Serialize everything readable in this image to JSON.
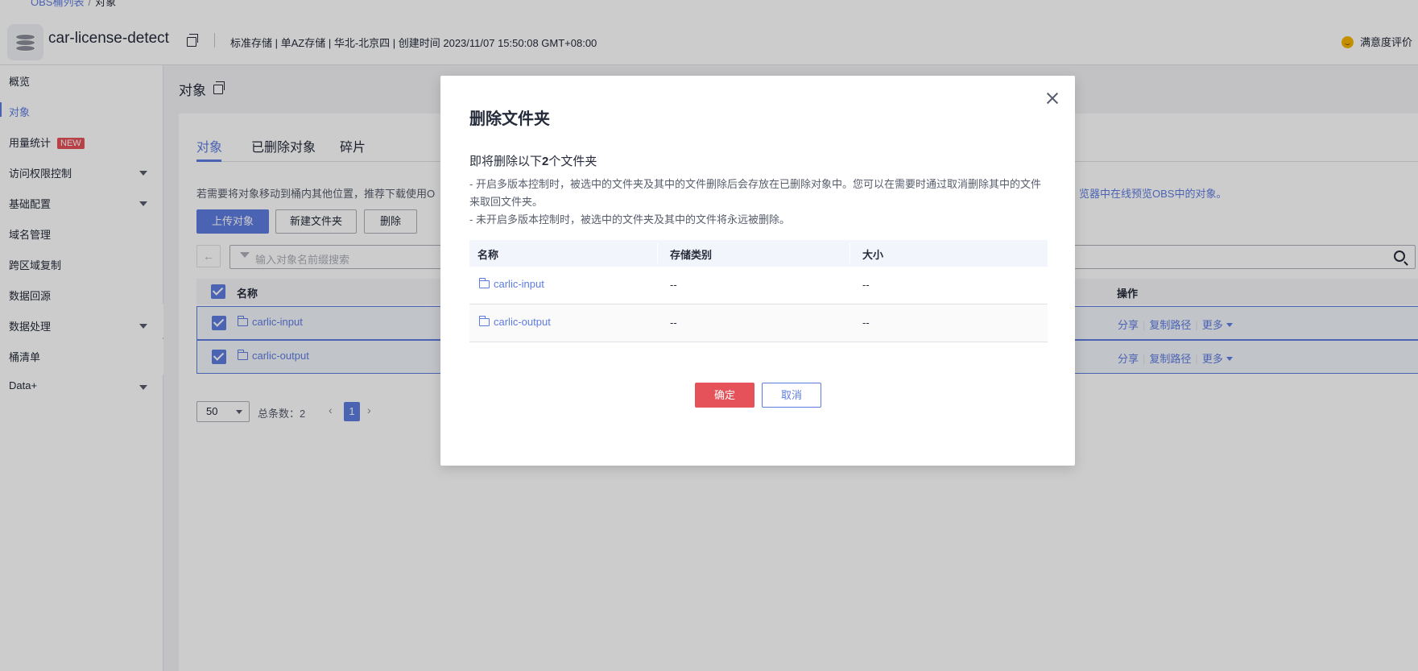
{
  "breadcrumb": {
    "parent": "OBS桶列表",
    "current": "对象"
  },
  "header": {
    "bucket_name": "car-license-detect",
    "meta": "标准存储 | 单AZ存储 | 华北-北京四 | 创建时间  2023/11/07 15:50:08 GMT+08:00",
    "satisfaction": "满意度评价"
  },
  "sidebar": {
    "items": [
      {
        "label": "概览"
      },
      {
        "label": "对象"
      },
      {
        "label": "用量统计",
        "badge": "NEW"
      },
      {
        "label": "访问权限控制"
      },
      {
        "label": "基础配置"
      },
      {
        "label": "域名管理"
      },
      {
        "label": "跨区域复制"
      },
      {
        "label": "数据回源"
      },
      {
        "label": "数据处理"
      },
      {
        "label": "桶清单"
      },
      {
        "label": "Data+"
      }
    ]
  },
  "main": {
    "title": "对象",
    "tabs": [
      {
        "label": "对象"
      },
      {
        "label": "已删除对象"
      },
      {
        "label": "碎片"
      }
    ],
    "tip_left": "若需要将对象移动到桶内其他位置，推荐下载使用O",
    "tip_right": "览器中在线预览OBS中的对象。",
    "buttons": {
      "upload": "上传对象",
      "new_folder": "新建文件夹",
      "delete": "删除"
    },
    "search_placeholder": "输入对象名前缀搜索",
    "table": {
      "col_name": "名称",
      "col_ops": "操作",
      "rows": [
        {
          "name": "carlic-input"
        },
        {
          "name": "carlic-output"
        }
      ],
      "ops": {
        "share": "分享",
        "copy_path": "复制路径",
        "more": "更多"
      }
    },
    "pagination": {
      "page_size": "50",
      "total": "总条数：2",
      "current_page": "1"
    }
  },
  "dialog": {
    "title": "删除文件夹",
    "intro_prefix": "即将删除以下",
    "intro_count": "2",
    "intro_suffix": "个文件夹",
    "note1": "- 开启多版本控制时，被选中的文件夹及其中的文件删除后会存放在已删除对象中。您可以在需要时通过取消删除其中的文件来取回文件夹。",
    "note2": "- 未开启多版本控制时，被选中的文件夹及其中的文件将永远被删除。",
    "table": {
      "headers": {
        "name": "名称",
        "storage": "存储类别",
        "size": "大小"
      },
      "rows": [
        {
          "name": "carlic-input",
          "storage": "--",
          "size": "--"
        },
        {
          "name": "carlic-output",
          "storage": "--",
          "size": "--"
        }
      ]
    },
    "confirm": "确定",
    "cancel": "取消"
  },
  "colors": {
    "accent": "#5e7ce0",
    "danger": "#e6525a",
    "overlay": "rgba(0,0,0,0.2)"
  }
}
